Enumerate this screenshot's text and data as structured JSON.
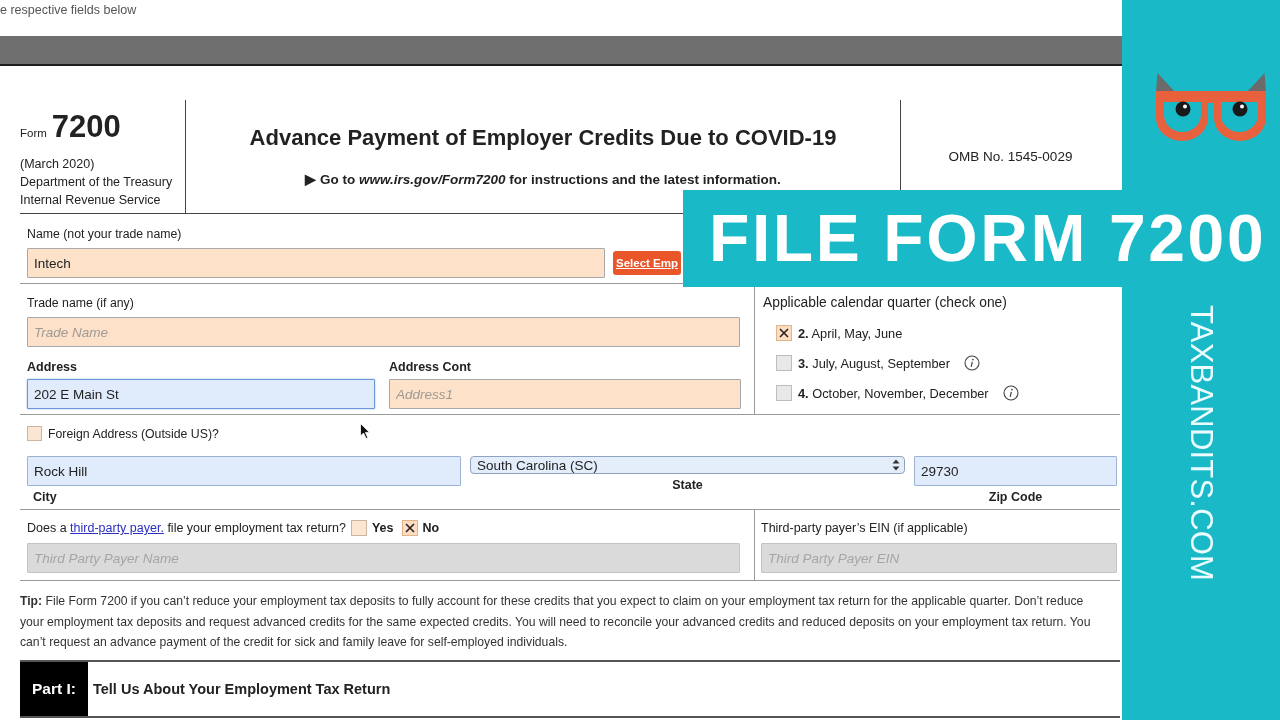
{
  "top_hint": "e respective fields below",
  "form_header": {
    "form_label": "Form",
    "form_number": "7200",
    "revision": "(March 2020)",
    "agency": [
      "Department of the Treasury",
      "Internal Revenue Service"
    ],
    "title": "Advance Payment of Employer Credits Due to COVID-19",
    "instructions": "▶ Go to *www.irs.gov/Form7200* for instructions and the latest information.",
    "omb": "OMB No. 1545-0029"
  },
  "name_section": {
    "label": "Name (not your trade name)",
    "field": {
      "value": "Intech",
      "highlighted": true,
      "disabled": false,
      "focused": false
    },
    "button": "Select Emp"
  },
  "trade_name": {
    "label": "Trade name (if any)",
    "field": {
      "placeholder": "Trade Name",
      "highlighted": true,
      "disabled": false,
      "focused": false
    }
  },
  "address": {
    "label": "Address",
    "field": {
      "value": "202 E Main St",
      "highlighted": false,
      "disabled": false,
      "focused": true
    }
  },
  "address_cont": {
    "label": "Address Cont",
    "field": {
      "placeholder": "Address1",
      "highlighted": true,
      "disabled": false,
      "focused": false
    }
  },
  "quarter": {
    "heading": "Applicable calendar quarter (check one)",
    "options": [
      {
        "label": "**2.** April, May, June",
        "checked": true,
        "info": false
      },
      {
        "label": "**3.** July, August, September",
        "checked": false,
        "info": true
      },
      {
        "label": "**4.** October, November, December",
        "checked": false,
        "info": true
      }
    ]
  },
  "foreign_address": {
    "label": "Foreign Address (Outside US)?",
    "checked": false
  },
  "city": {
    "label": "City",
    "field": {
      "value": "Rock Hill",
      "highlighted": false,
      "disabled": false,
      "focused": false
    }
  },
  "state": {
    "label": "State",
    "value": "South Carolina (SC)"
  },
  "zip": {
    "label": "Zip Code",
    "field": {
      "value": "29730",
      "highlighted": false,
      "disabled": false,
      "focused": false
    }
  },
  "third_party": {
    "question_start": "Does a",
    "link": "third-party payer.",
    "question_end": "file your employment tax return?",
    "options": [
      {
        "label": "Yes",
        "checked": false
      },
      {
        "label": "No",
        "checked": true
      }
    ],
    "name_field": {
      "placeholder": "Third Party Payer Name",
      "disabled": true,
      "focused": false
    },
    "ein_label": "Third-party payer’s EIN (if applicable)",
    "ein_field": {
      "placeholder": "Third Party Payer EIN",
      "disabled": true,
      "focused": false
    }
  },
  "tip": "**Tip:** File Form 7200 if you can’t reduce your employment tax deposits to fully account for these credits that you expect to claim on your employment tax return for the applicable quarter. Don’t reduce your employment tax deposits and request advanced credits for the same expected credits. You will need to reconcile your advanced credits and reduced deposits on your employment tax return. You can’t request an advance payment of the credit for sick and family leave for self-employed individuals.",
  "part": {
    "label": "Part I:",
    "title": "Tell Us About Your Employment Tax Return"
  },
  "banner": "FILE FORM 7200",
  "site": "TAXBANDITS.COM"
}
